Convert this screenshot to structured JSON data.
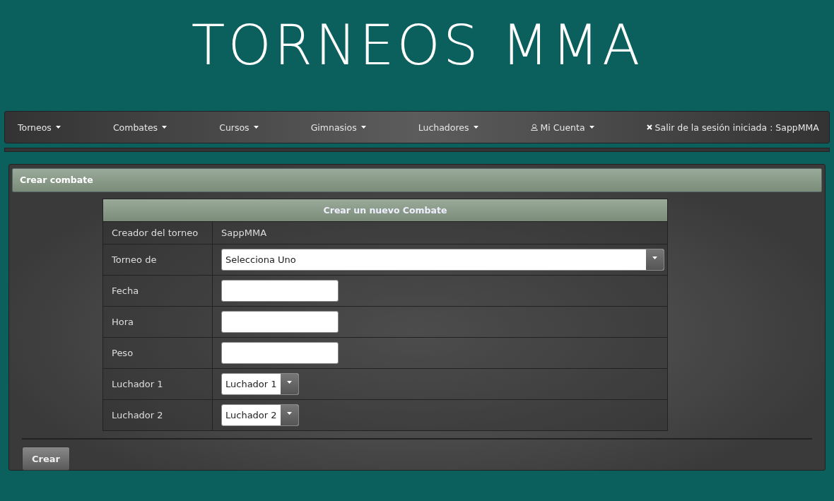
{
  "site_title": "TORNEOS MMA",
  "nav": [
    {
      "label": "Torneos",
      "kind": "menu"
    },
    {
      "label": "Combates",
      "kind": "menu"
    },
    {
      "label": "Cursos",
      "kind": "menu"
    },
    {
      "label": "Gimnasios",
      "kind": "menu"
    },
    {
      "label": "Luchadores",
      "kind": "menu"
    },
    {
      "label": "Mi Cuenta",
      "kind": "account"
    },
    {
      "label": "Salir de la sesión iniciada : SappMMA",
      "kind": "logout"
    }
  ],
  "panel": {
    "title": "Crear combate",
    "form": {
      "title": "Crear un nuevo Combate",
      "rows": [
        {
          "label": "Creador del torneo",
          "kind": "text",
          "value": "SappMMA"
        },
        {
          "label": "Torneo de",
          "kind": "select",
          "value": "Selecciona Uno"
        },
        {
          "label": "Fecha",
          "kind": "input"
        },
        {
          "label": "Hora",
          "kind": "input"
        },
        {
          "label": "Peso",
          "kind": "input"
        },
        {
          "label": "Luchador 1",
          "kind": "small-select",
          "value": "Luchador 1"
        },
        {
          "label": "Luchador 2",
          "kind": "small-select",
          "value": "Luchador 2"
        }
      ]
    },
    "button": "Crear"
  }
}
